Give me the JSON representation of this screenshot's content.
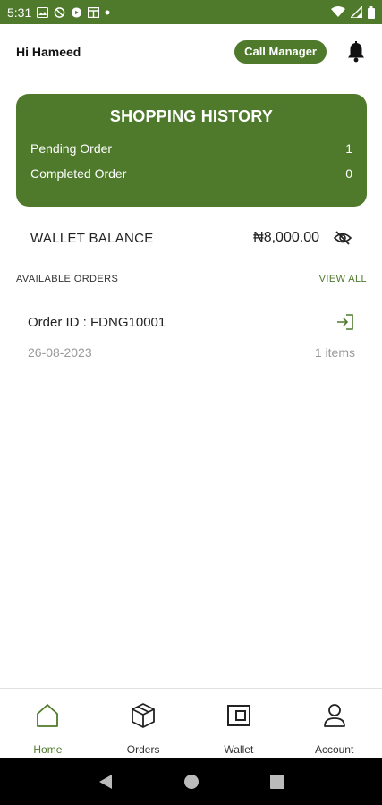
{
  "status_bar": {
    "time": "5:31",
    "left_icons": [
      "gallery-icon",
      "at-icon",
      "play-icon",
      "grid-icon",
      "dot-icon"
    ],
    "right_icons": [
      "wifi-icon",
      "signal-icon",
      "battery-icon"
    ]
  },
  "header": {
    "greeting": "Hi Hameed",
    "call_manager_label": "Call Manager",
    "notification_icon": "bell-icon"
  },
  "shopping_history": {
    "title": "SHOPPING HISTORY",
    "rows": [
      {
        "label": "Pending Order",
        "value": "1"
      },
      {
        "label": "Completed Order",
        "value": "0"
      }
    ]
  },
  "wallet": {
    "label": "WALLET BALANCE",
    "amount": "₦8,000.00",
    "visibility_icon": "eye-off-icon"
  },
  "available_orders": {
    "title": "AVAILABLE ORDERS",
    "view_all_label": "VIEW ALL",
    "orders": [
      {
        "id_text": "Order ID : FDNG10001",
        "date": "26-08-2023",
        "items": "1 items"
      }
    ]
  },
  "bottom_nav": {
    "items": [
      {
        "label": "Home",
        "icon": "home-icon",
        "active": true
      },
      {
        "label": "Orders",
        "icon": "package-icon",
        "active": false
      },
      {
        "label": "Wallet",
        "icon": "wallet-icon",
        "active": false
      },
      {
        "label": "Account",
        "icon": "user-icon",
        "active": false
      }
    ]
  },
  "colors": {
    "primary": "#4f7a2c",
    "muted_text": "#9a9a9a"
  }
}
